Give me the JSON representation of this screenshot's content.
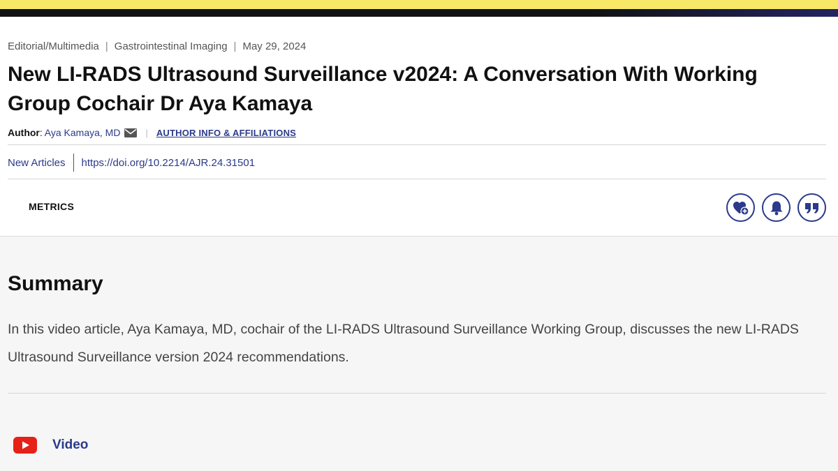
{
  "header": {
    "category": "Editorial/Multimedia",
    "section": "Gastrointestinal Imaging",
    "date": "May 29, 2024",
    "separator": "|"
  },
  "article": {
    "title": "New LI-RADS Ultrasound Surveillance v2024: A Conversation With Working Group Cochair Dr Aya Kamaya",
    "author_label": "Author",
    "author_name": "Aya Kamaya, MD",
    "affiliations_link": "AUTHOR INFO & AFFILIATIONS",
    "new_articles_link": "New Articles",
    "doi": "https://doi.org/10.2214/AJR.24.31501"
  },
  "toolbar": {
    "metrics_label": "METRICS",
    "icons": [
      "favorite-add-icon",
      "bell-icon",
      "quote-icon"
    ]
  },
  "summary": {
    "heading": "Summary",
    "text": "In this video article, Aya Kamaya, MD, cochair of the LI-RADS Ultrasound Surveillance Working Group, discusses the new LI-RADS Ultrasound Surveillance version 2024 recommendations."
  },
  "video": {
    "label": "Video",
    "icon": "youtube-play-icon"
  },
  "colors": {
    "accent": "#2b3a8a",
    "band_yellow": "#f8e868",
    "band_dark": "#111111",
    "youtube_red": "#e62117"
  }
}
